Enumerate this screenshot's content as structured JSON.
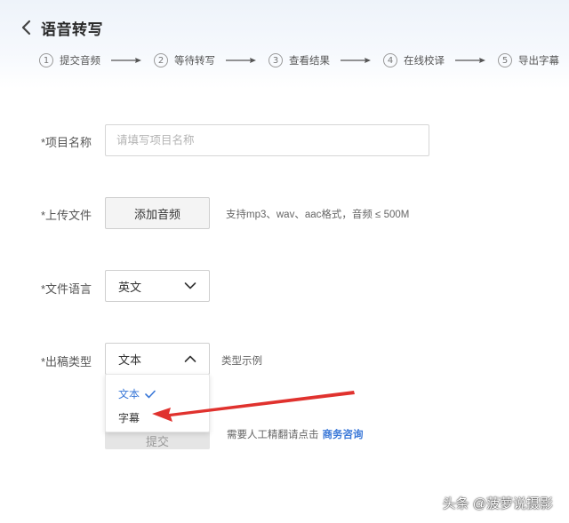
{
  "header": {
    "title": "语音转写",
    "back_icon": "chevron-left-icon"
  },
  "steps": [
    {
      "num": "1",
      "label": "提交音频"
    },
    {
      "num": "2",
      "label": "等待转写"
    },
    {
      "num": "3",
      "label": "查看结果"
    },
    {
      "num": "4",
      "label": "在线校译"
    },
    {
      "num": "5",
      "label": "导出字幕"
    }
  ],
  "form": {
    "project_name": {
      "label": "*项目名称",
      "value": "",
      "placeholder": "请填写项目名称"
    },
    "upload": {
      "label": "*上传文件",
      "button_label": "添加音频",
      "hint": "支持mp3、wav、aac格式，音频 ≤ 500M"
    },
    "language": {
      "label": "*文件语言",
      "value": "英文"
    },
    "output_type": {
      "label": "*出稿类型",
      "value": "文本",
      "example_link": "类型示例",
      "options": [
        {
          "label": "文本",
          "selected": true
        },
        {
          "label": "字幕",
          "selected": false
        }
      ]
    },
    "submit": {
      "label": "提交"
    },
    "consult": {
      "text": "需要人工精翻请点击",
      "link": "商务咨询"
    }
  },
  "annotation": {
    "color": "#e0322e"
  },
  "watermark": "头条 @菠萝说摄影",
  "colors": {
    "accent": "#3a78d8",
    "arrow": "#e0322e"
  }
}
